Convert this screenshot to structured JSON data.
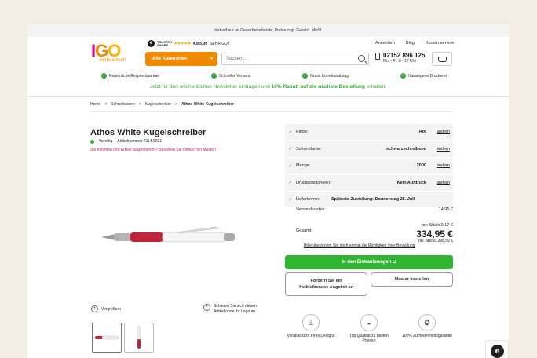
{
  "topbar": {
    "text": "Verkauf nur an Gewerbetreibende, Preise zzgl. Gesetzl. MwSt."
  },
  "logo": {
    "brand": "IGO",
    "tagline": "werbeartikel!"
  },
  "trusted_shops": {
    "label": "TRUSTED SHOPS",
    "rating": "4.8/5.00",
    "rating_text": "SEHR GUT"
  },
  "nav": {
    "categories_label": "Alle Kategorien",
    "search_placeholder": "Suchen...",
    "links": [
      "Anmelden",
      "Blog",
      "Kundenservice"
    ]
  },
  "contact": {
    "phone": "02152 896 125",
    "hours": "Mo. - Fr. 8 - 17 Uhr"
  },
  "usps": [
    "Persönliche Ansprechpartner",
    "Schneller Versand",
    "Gratis Korrekturabzug",
    "Hauseigene Druckerei"
  ],
  "newsletter": {
    "part1": "Jetzt für den wöchentlichen Newsletter eintragen und ",
    "bold": "10% Rabatt auf die nächste Bestellung",
    "part2": " erhalten."
  },
  "breadcrumbs": [
    "Home",
    "Schreibwaren",
    "Kugelschreiber",
    "Athos White Kugelschreiber"
  ],
  "product": {
    "title": "Athos White Kugelschreiber",
    "stock": "Vorrätig",
    "article_no": "Artikelnummer 2114.6021",
    "sample_hint": "Sie möchten den Artikel ausprobieren? Bestellen Sie einfach ein Muster!",
    "zoom_label": "Vergrößern",
    "logo_preview_label": "Schauen Sie sich diesen Artikel ohne Ihr Logo an"
  },
  "options": [
    {
      "label": "Farbe:",
      "value": "Rot",
      "edit": "ändern"
    },
    {
      "label": "Schreibfarbe:",
      "value": "schwarzschreibend",
      "edit": "ändern"
    },
    {
      "label": "Menge:",
      "value": "2000",
      "edit": "ändern"
    },
    {
      "label": "Druckposition(en):",
      "value": "Kein Aufdruck",
      "edit": "ändern"
    },
    {
      "label": "Liefertermin:",
      "value": "Späteste Zustellung: Donnerstag 25. Juli",
      "edit": ""
    }
  ],
  "pricing": {
    "shipping_label": "Versandkosten",
    "shipping_value": "14,95 €",
    "per_piece": "pro Stück 0,17 €",
    "total_label": "Gesamt",
    "total": "334,95 €",
    "incl_vat": "inkl. MwSt.  398,59 €",
    "note": "Bitte überprüfen Sie noch einmal die Richtigkeit Ihrer Bestellung"
  },
  "buttons": {
    "cart": "In den Einkaufswagen",
    "offer": "Fordern Sie ein freibleibendes Angebot an",
    "sample": "Muster bestellen"
  },
  "features": [
    "Vorabansicht Ihres Designs",
    "Top Qualität zu besten Preisen",
    "100% Zufriedenheitsgarantie"
  ],
  "colors": {
    "accent": "#f08a00",
    "green": "#2fb52f",
    "pen_red": "#c0243a"
  }
}
